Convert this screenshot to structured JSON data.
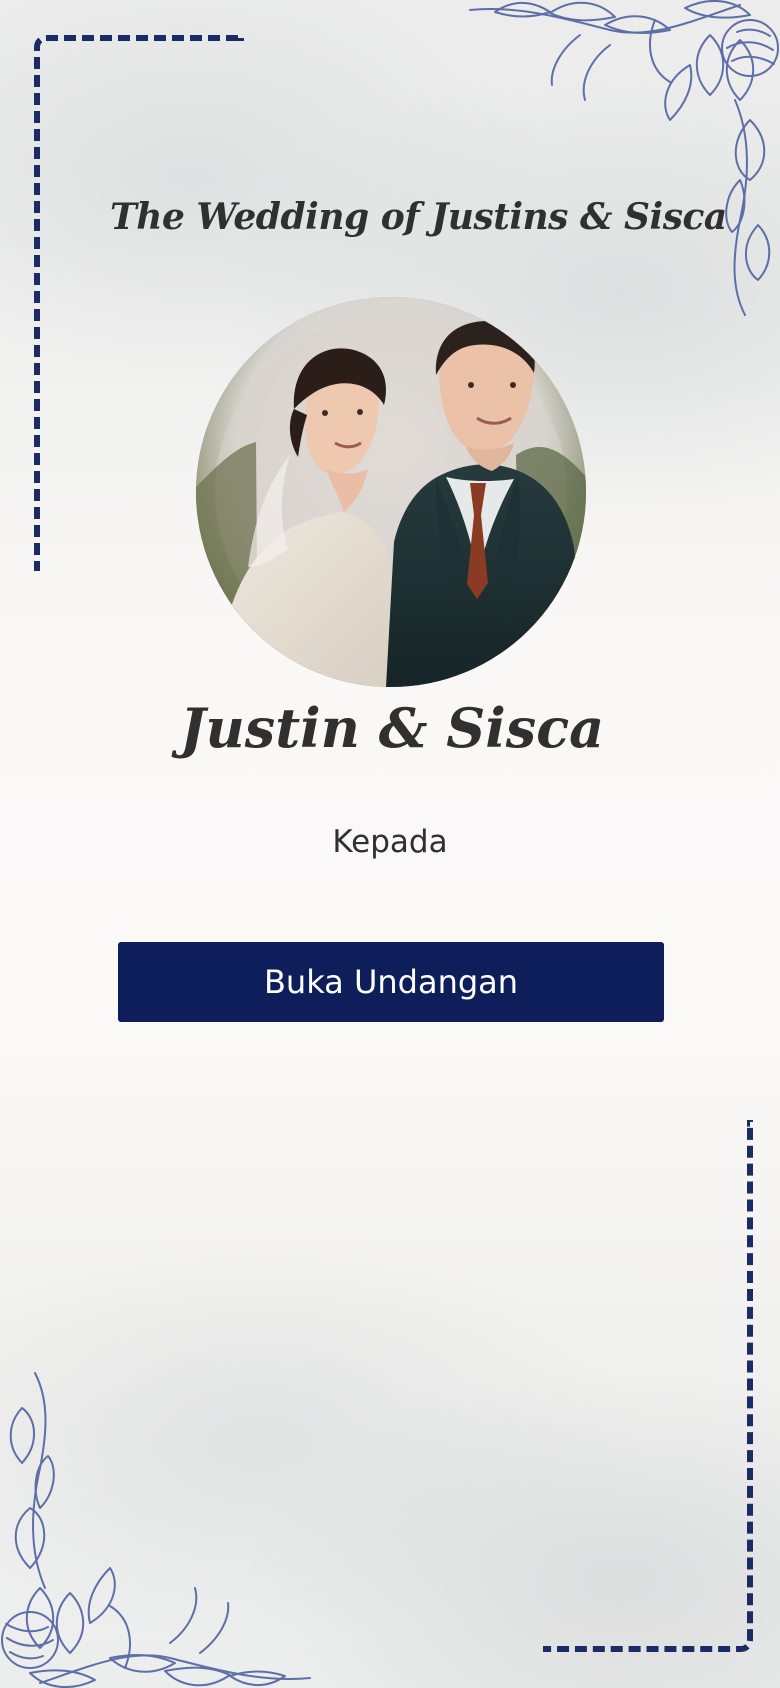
{
  "invitation": {
    "title": "The Wedding of Justins & Sisca",
    "couple_names": "Justin & Sisca",
    "recipient_label": "Kepada",
    "open_button_label": "Buka Undangan"
  },
  "colors": {
    "primary": "#0d1e5b",
    "frame_line": "#1b2b64",
    "heading_text": "#303030",
    "button_text": "#ffffff",
    "background": "#f7f6f4",
    "floral_line": "#5e6fa8"
  },
  "icons": {
    "floral_top": "floral-corner-ornament",
    "floral_bottom": "floral-corner-ornament"
  }
}
